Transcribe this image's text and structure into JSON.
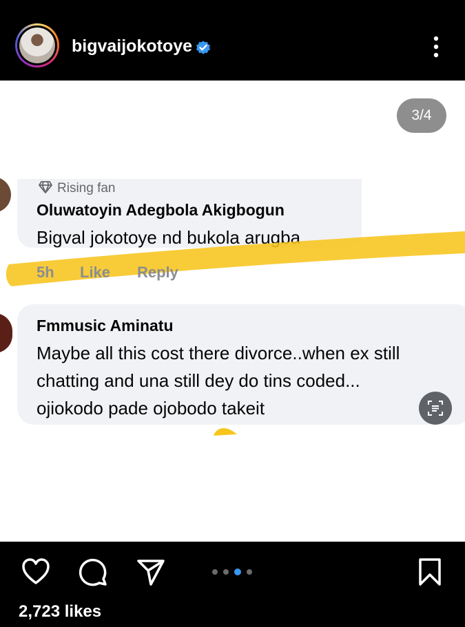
{
  "header": {
    "username": "bigvaijokotoye",
    "verified_icon": "verified-badge-icon",
    "more_icon": "more-options-icon"
  },
  "post": {
    "carousel_counter": "3/4",
    "comments": [
      {
        "badge": "Rising fan",
        "author": "Oluwatoyin Adegbola Akigbogun",
        "text": "Bigval jokotoye nd bukola arugba",
        "time": "5h",
        "like_label": "Like",
        "reply_label": "Reply"
      },
      {
        "author": "Fmmusic Aminatu",
        "text_lines": [
          "Maybe all this cost there divorce..when ex still",
          "chatting and una still dey do tins coded...",
          "ojiokodo pade ojobodo takeit"
        ]
      }
    ],
    "highlight_color": "#f7c51c"
  },
  "footer": {
    "likes": "2,723 likes",
    "carousel": {
      "total": 4,
      "active": 3
    },
    "icons": [
      "heart-icon",
      "comment-icon",
      "share-icon",
      "bookmark-icon"
    ]
  },
  "colors": {
    "verified": "#3897f0",
    "bubble": "#f0f2f5",
    "meta": "#8a8d91"
  }
}
